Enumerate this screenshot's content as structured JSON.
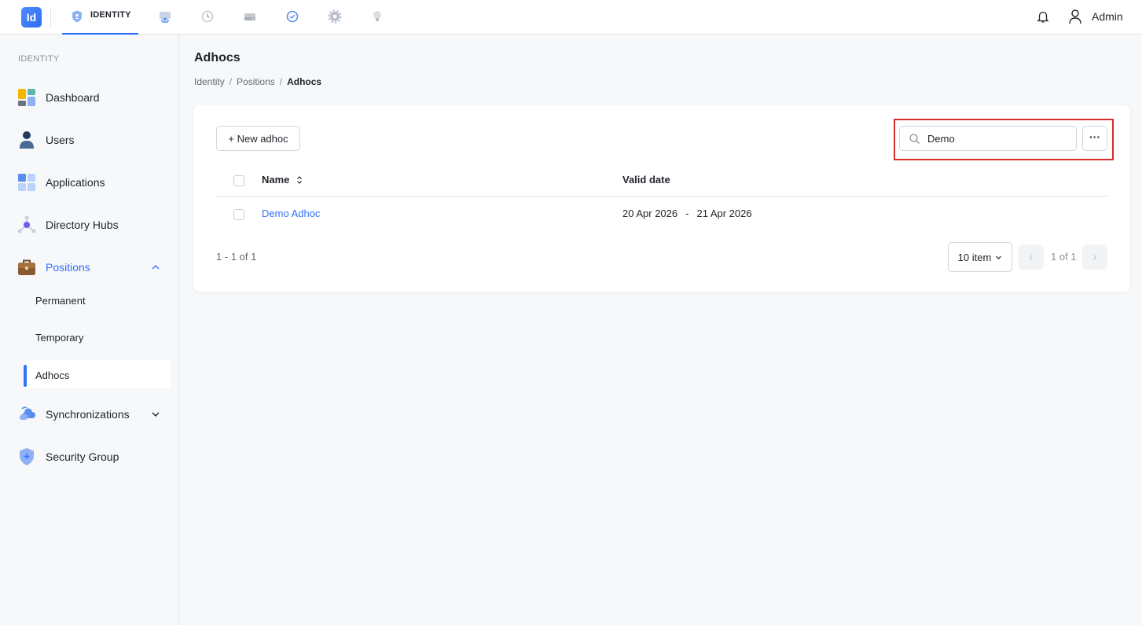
{
  "app": {
    "logo_text": "Id",
    "active_module": "IDENTITY",
    "module_icons": [
      "monitor-icon",
      "history-icon",
      "drive-icon",
      "check-circle-icon",
      "settings-icon",
      "lightbulb-icon"
    ],
    "user_name": "Admin"
  },
  "sidebar": {
    "section_label": "IDENTITY",
    "items": [
      {
        "label": "Dashboard",
        "icon": "dashboard-icon"
      },
      {
        "label": "Users",
        "icon": "user-icon"
      },
      {
        "label": "Applications",
        "icon": "applications-icon"
      },
      {
        "label": "Directory Hubs",
        "icon": "hub-icon"
      },
      {
        "label": "Positions",
        "icon": "briefcase-icon",
        "expanded": true
      },
      {
        "label": "Synchronizations",
        "icon": "cloud-sync-icon",
        "expanded": false
      },
      {
        "label": "Security Group",
        "icon": "shield-icon"
      }
    ],
    "positions_children": [
      "Permanent",
      "Temporary",
      "Adhocs"
    ],
    "selected_child": "Adhocs"
  },
  "page": {
    "title": "Adhocs",
    "breadcrumb": [
      "Identity",
      "Positions",
      "Adhocs"
    ]
  },
  "toolbar": {
    "new_button_label": "+ New adhoc",
    "search_value": "Demo",
    "more_label": "···"
  },
  "table": {
    "columns": [
      "Name",
      "Valid date"
    ],
    "rows": [
      {
        "name": "Demo Adhoc",
        "valid_from": "20 Apr 2026",
        "valid_to": "21 Apr 2026"
      }
    ]
  },
  "pagination": {
    "summary": "1 - 1 of 1",
    "page_size": "10 item",
    "page_text": "1 of 1"
  },
  "colors": {
    "accent": "#3370ff",
    "highlight_border": "#d92d2d"
  }
}
